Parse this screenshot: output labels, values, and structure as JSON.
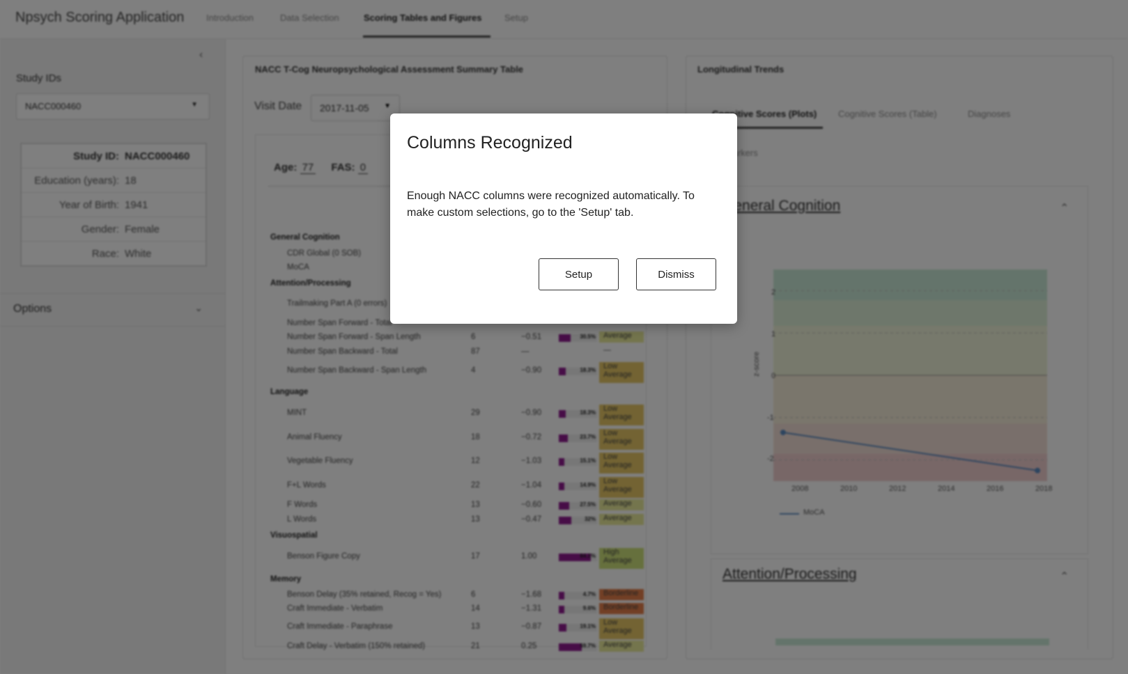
{
  "app": {
    "title": "Npsych Scoring Application",
    "tabs": [
      "Introduction",
      "Data Selection",
      "Scoring Tables and Figures",
      "Setup"
    ]
  },
  "sidebar": {
    "study_ids_label": "Study IDs",
    "selected_id": "NACC000460",
    "info": [
      {
        "k": "Study ID:",
        "v": "NACC000460"
      },
      {
        "k": "Education (years):",
        "v": "18"
      },
      {
        "k": "Year of Birth:",
        "v": "1941"
      },
      {
        "k": "Gender:",
        "v": "Female"
      },
      {
        "k": "Race:",
        "v": "White"
      }
    ],
    "options_label": "Options"
  },
  "summary": {
    "title": "NACC T-Cog Neuropsychological Assessment Summary Table",
    "visit_date_label": "Visit Date",
    "visit_date": "2017-11-05",
    "age_label": "Age:",
    "age": "77",
    "fas_label": "FAS:",
    "fas": "0",
    "rows": [
      {
        "sec": "General Cognition"
      },
      {
        "n": "CDR Global (0 SOB)"
      },
      {
        "n": "MoCA"
      },
      {
        "sec": "Attention/Processing"
      },
      {
        "n": "Trailmaking Part A (0 errors)"
      },
      {
        "n": "Number Span Forward - Total"
      },
      {
        "n": "Number Span Forward - Span Length",
        "raw": "6",
        "z": "−0.51",
        "p": 30.5,
        "pl": "30.5%",
        "d": "Average"
      },
      {
        "n": "Number Span Backward - Total",
        "raw": "87",
        "z": "—",
        "d": "—"
      },
      {
        "n": "Number Span Backward - Span Length",
        "raw": "4",
        "z": "−0.90",
        "p": 18.3,
        "pl": "18.3%",
        "d": "Low Average"
      },
      {
        "sec": "Language"
      },
      {
        "n": "MINT",
        "raw": "29",
        "z": "−0.90",
        "p": 18.3,
        "pl": "18.3%",
        "d": "Low Average"
      },
      {
        "n": "Animal Fluency",
        "raw": "18",
        "z": "−0.72",
        "p": 23.7,
        "pl": "23.7%",
        "d": "Low Average"
      },
      {
        "n": "Vegetable Fluency",
        "raw": "12",
        "z": "−1.03",
        "p": 15.1,
        "pl": "15.1%",
        "d": "Low Average"
      },
      {
        "n": "F+L Words",
        "raw": "22",
        "z": "−1.04",
        "p": 14.9,
        "pl": "14.9%",
        "d": "Low Average"
      },
      {
        "n": "F Words",
        "raw": "13",
        "z": "−0.60",
        "p": 27.5,
        "pl": "27.5%",
        "d": "Average"
      },
      {
        "n": "L Words",
        "raw": "13",
        "z": "−0.47",
        "p": 32,
        "pl": "32%",
        "d": "Average"
      },
      {
        "sec": "Visuospatial"
      },
      {
        "n": "Benson Figure Copy",
        "raw": "17",
        "z": "1.00",
        "p": 84.1,
        "pl": "84.1%",
        "d": "High Average"
      },
      {
        "sec": "Memory"
      },
      {
        "n": "Benson Delay (35% retained, Recog = Yes)",
        "raw": "6",
        "z": "−1.68",
        "p": 4.7,
        "pl": "4.7%",
        "d": "Borderline"
      },
      {
        "n": "Craft Immediate - Verbatim",
        "raw": "14",
        "z": "−1.31",
        "p": 9.6,
        "pl": "9.6%",
        "d": "Borderline"
      },
      {
        "n": "Craft Immediate - Paraphrase",
        "raw": "13",
        "z": "−0.87",
        "p": 19.1,
        "pl": "19.1%",
        "d": "Low Average"
      },
      {
        "n": "Craft Delay - Verbatim (150% retained)",
        "raw": "21",
        "z": "0.25",
        "p": 59.7,
        "pl": "59.7%",
        "d": "Average"
      }
    ]
  },
  "trends": {
    "title": "Longitudinal Trends",
    "tabs": [
      "Cognitive Scores (Plots)",
      "Cognitive Scores (Table)",
      "Diagnoses"
    ],
    "tab2": "Biomarkers",
    "sections": [
      "General Cognition",
      "Attention/Processing"
    ],
    "y_label": "z-score",
    "y_ticks": [
      "2",
      "1",
      "0",
      "-1",
      "-2"
    ],
    "x_ticks": [
      "2008",
      "2010",
      "2012",
      "2014",
      "2016",
      "2018"
    ],
    "legend": "MoCA",
    "line_color": "#5b8ac0"
  },
  "chart_data": {
    "type": "line",
    "x": [
      2007.4,
      2017.9
    ],
    "series": [
      {
        "name": "MoCA",
        "values": [
          -1.35,
          -2.25
        ]
      }
    ],
    "ylabel": "z-score",
    "xlim": [
      2007,
      2018.3
    ],
    "ylim": [
      -2.5,
      2.5
    ]
  },
  "modal": {
    "title": "Columns Recognized",
    "body": "Enough NACC columns were recognized automatically. To make custom selections, go to the 'Setup' tab.",
    "setup_label": "Setup",
    "dismiss_label": "Dismiss"
  }
}
